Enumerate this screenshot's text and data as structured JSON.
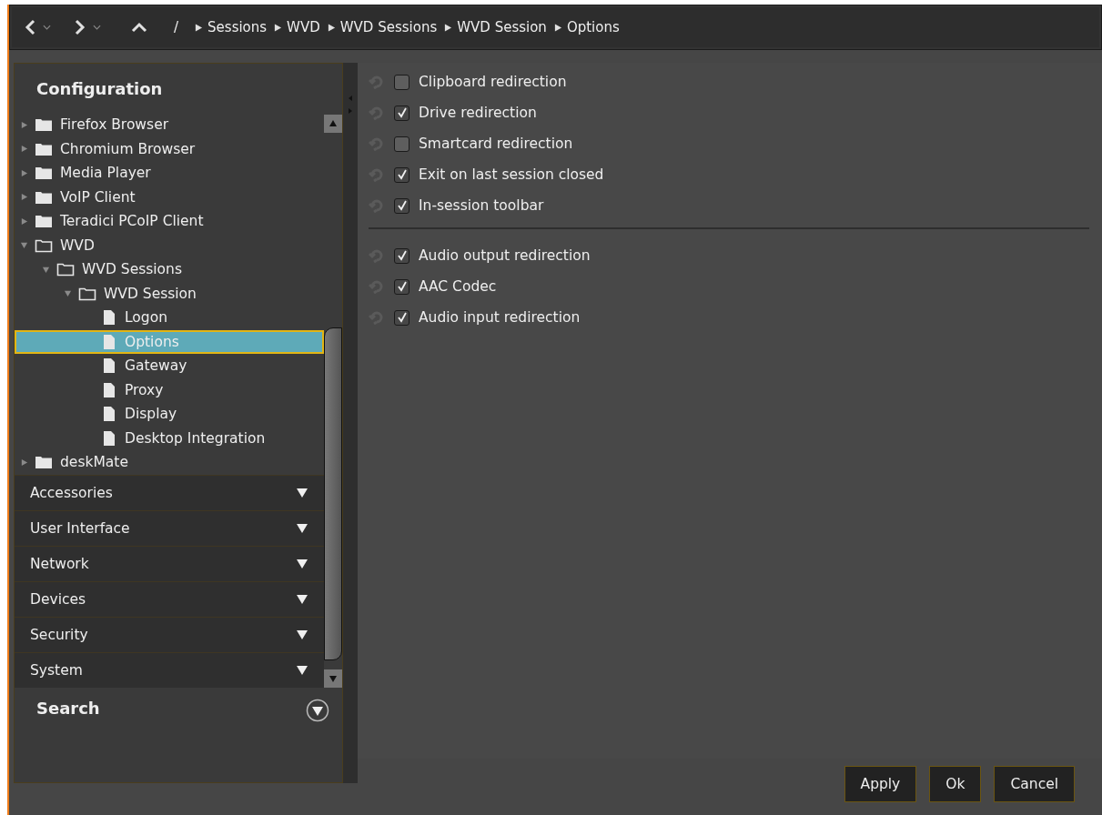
{
  "toolbar": {
    "root": "/",
    "breadcrumb": [
      "Sessions",
      "WVD",
      "WVD Sessions",
      "WVD Session",
      "Options"
    ]
  },
  "sidebar": {
    "title": "Configuration",
    "tree": [
      {
        "label": "Firefox Browser",
        "kind": "folder",
        "expanded": false,
        "selected": false
      },
      {
        "label": "Chromium Browser",
        "kind": "folder",
        "expanded": false,
        "selected": false
      },
      {
        "label": "Media Player",
        "kind": "folder",
        "expanded": false,
        "selected": false
      },
      {
        "label": "VoIP Client",
        "kind": "folder",
        "expanded": false,
        "selected": false
      },
      {
        "label": "Teradici PCoIP Client",
        "kind": "folder",
        "expanded": false,
        "selected": false
      },
      {
        "label": "WVD",
        "kind": "folder",
        "expanded": true,
        "selected": false,
        "children": [
          {
            "label": "WVD Sessions",
            "kind": "folder",
            "expanded": true,
            "selected": false,
            "children": [
              {
                "label": "WVD Session",
                "kind": "folder",
                "expanded": true,
                "selected": false,
                "children": [
                  {
                    "label": "Logon",
                    "kind": "page",
                    "selected": false
                  },
                  {
                    "label": "Options",
                    "kind": "page",
                    "selected": true
                  },
                  {
                    "label": "Gateway",
                    "kind": "page",
                    "selected": false
                  },
                  {
                    "label": "Proxy",
                    "kind": "page",
                    "selected": false
                  },
                  {
                    "label": "Display",
                    "kind": "page",
                    "selected": false
                  },
                  {
                    "label": "Desktop Integration",
                    "kind": "page",
                    "selected": false
                  }
                ]
              }
            ]
          }
        ]
      },
      {
        "label": "deskMate",
        "kind": "folder",
        "expanded": false,
        "selected": false
      }
    ],
    "sections": [
      "Accessories",
      "User Interface",
      "Network",
      "Devices",
      "Security",
      "System"
    ],
    "search": "Search"
  },
  "options": [
    [
      {
        "label": "Clipboard redirection",
        "checked": false
      },
      {
        "label": "Drive redirection",
        "checked": true
      },
      {
        "label": "Smartcard redirection",
        "checked": false
      },
      {
        "label": "Exit on last session closed",
        "checked": true
      },
      {
        "label": "In-session toolbar",
        "checked": true
      }
    ],
    [
      {
        "label": "Audio output redirection",
        "checked": true
      },
      {
        "label": "AAC Codec",
        "checked": true
      },
      {
        "label": "Audio input redirection",
        "checked": true
      }
    ]
  ],
  "buttons": [
    "Apply",
    "Ok",
    "Cancel"
  ]
}
